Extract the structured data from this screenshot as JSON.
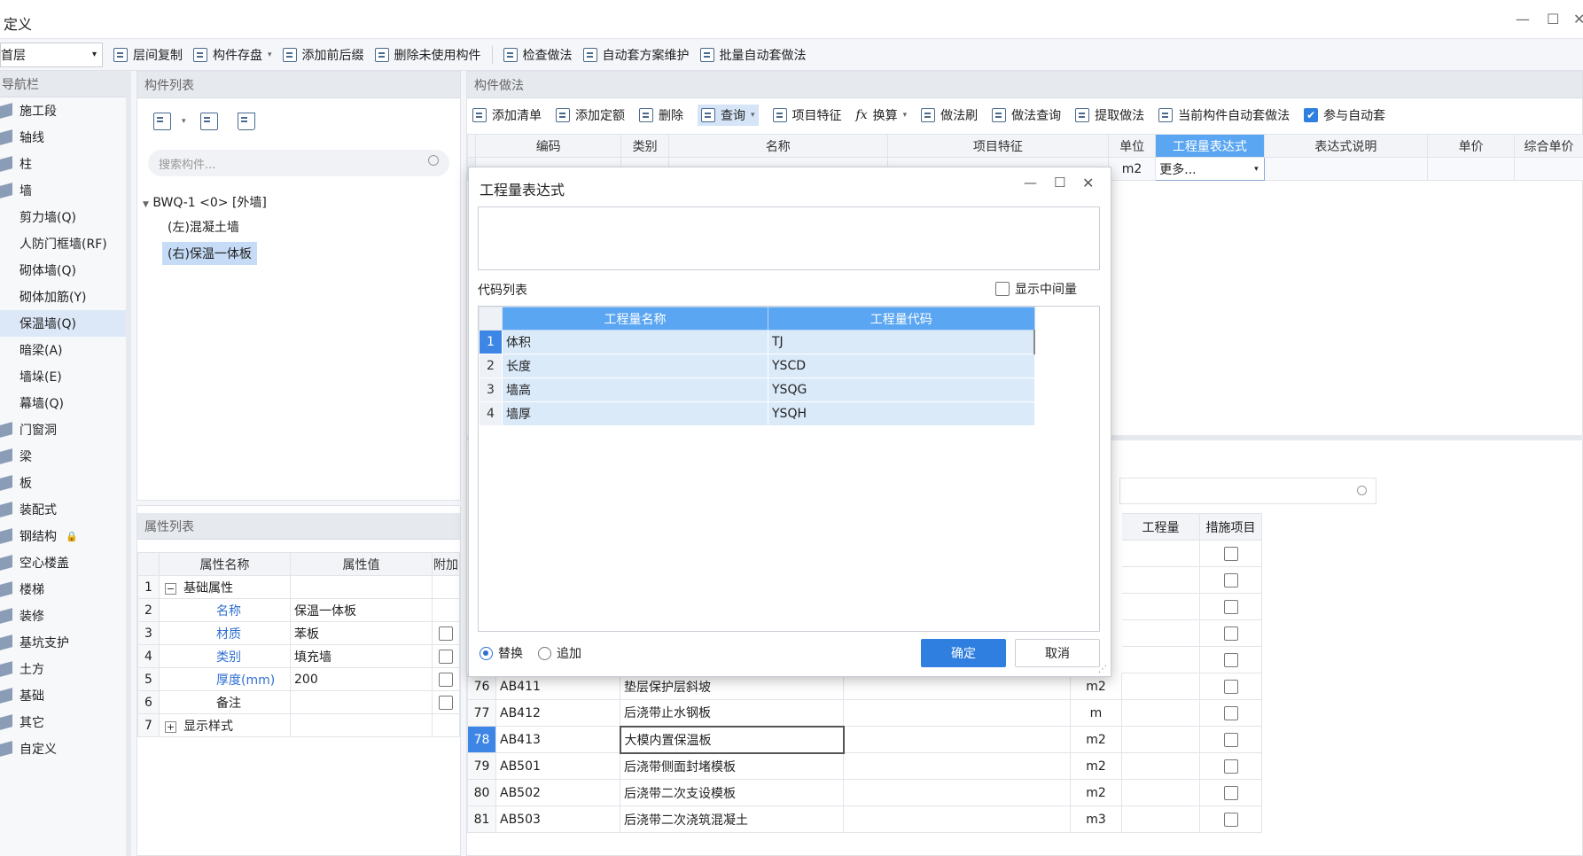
{
  "window": {
    "title": "定义",
    "minimize": "—",
    "maximize": "☐",
    "close": "✕"
  },
  "toolbar": {
    "floor": "首层",
    "items": [
      "层间复制",
      "构件存盘",
      "添加前后缀",
      "删除未使用构件",
      "检查做法",
      "自动套方案维护",
      "批量自动套做法"
    ]
  },
  "nav": {
    "header": "导航栏",
    "items": [
      {
        "label": "施工段",
        "sub": false
      },
      {
        "label": "轴线",
        "sub": false
      },
      {
        "label": "柱",
        "sub": false
      },
      {
        "label": "墙",
        "sub": false
      },
      {
        "label": "剪力墙(Q)",
        "sub": true
      },
      {
        "label": "人防门框墙(RF)",
        "sub": true
      },
      {
        "label": "砌体墙(Q)",
        "sub": true
      },
      {
        "label": "砌体加筋(Y)",
        "sub": true
      },
      {
        "label": "保温墙(Q)",
        "sub": true,
        "selected": true
      },
      {
        "label": "暗梁(A)",
        "sub": true
      },
      {
        "label": "墙垛(E)",
        "sub": true
      },
      {
        "label": "幕墙(Q)",
        "sub": true
      },
      {
        "label": "门窗洞",
        "sub": false
      },
      {
        "label": "梁",
        "sub": false
      },
      {
        "label": "板",
        "sub": false
      },
      {
        "label": "装配式",
        "sub": false
      },
      {
        "label": "钢结构",
        "sub": false
      },
      {
        "label": "空心楼盖",
        "sub": false
      },
      {
        "label": "楼梯",
        "sub": false
      },
      {
        "label": "装修",
        "sub": false
      },
      {
        "label": "基坑支护",
        "sub": false
      },
      {
        "label": "土方",
        "sub": false
      },
      {
        "label": "基础",
        "sub": false
      },
      {
        "label": "其它",
        "sub": false
      },
      {
        "label": "自定义",
        "sub": false
      }
    ]
  },
  "components": {
    "header": "构件列表",
    "search_placeholder": "搜索构件...",
    "tree_root": "BWQ-1 <0> [外墙]",
    "children": [
      "(左)混凝土墙",
      "(右)保温一体板"
    ]
  },
  "props": {
    "header": "属性列表",
    "columns": [
      "属性名称",
      "属性值",
      "附加"
    ],
    "rows": [
      {
        "n": "1",
        "name": "基础属性",
        "value": "",
        "group": "−"
      },
      {
        "n": "2",
        "name": "名称",
        "value": "保温一体板"
      },
      {
        "n": "3",
        "name": "材质",
        "value": "苯板",
        "chk": true
      },
      {
        "n": "4",
        "name": "类别",
        "value": "填充墙",
        "chk": true
      },
      {
        "n": "5",
        "name": "厚度(mm)",
        "value": "200",
        "chk": true
      },
      {
        "n": "6",
        "name": "备注",
        "value": "",
        "chk": true,
        "plain": true
      },
      {
        "n": "7",
        "name": "显示样式",
        "value": "",
        "group": "+"
      }
    ]
  },
  "method": {
    "header": "构件做法",
    "tools": [
      "添加清单",
      "添加定额",
      "删除",
      "查询",
      "项目特征",
      "换算",
      "做法刷",
      "做法查询",
      "提取做法",
      "当前构件自动套做法",
      "参与自动套"
    ],
    "columns": [
      "编码",
      "类别",
      "名称",
      "项目特征",
      "单位",
      "工程量表达式",
      "表达式说明",
      "单价",
      "综合单价"
    ],
    "row": {
      "unit": "m2",
      "expr": "更多..."
    },
    "lower_columns": [
      "工程量",
      "措施项目"
    ],
    "lower_rows": [
      {
        "n": "76",
        "code": "AB411",
        "name": "垫层保护层斜坡",
        "unit": "m2"
      },
      {
        "n": "77",
        "code": "AB412",
        "name": "后浇带止水钢板",
        "unit": "m"
      },
      {
        "n": "78",
        "code": "AB413",
        "name": "大模内置保温板",
        "unit": "m2"
      },
      {
        "n": "79",
        "code": "AB501",
        "name": "后浇带侧面封堵模板",
        "unit": "m2"
      },
      {
        "n": "80",
        "code": "AB502",
        "name": "后浇带二次支设模板",
        "unit": "m2"
      },
      {
        "n": "81",
        "code": "AB503",
        "name": "后浇带二次浇筑混凝土",
        "unit": "m3"
      }
    ]
  },
  "dialog": {
    "title": "工程量表达式",
    "code_list": "代码列表",
    "show_mid": "显示中间量",
    "columns": [
      "工程量名称",
      "工程量代码"
    ],
    "rows": [
      {
        "n": "1",
        "name": "体积",
        "code": "TJ"
      },
      {
        "n": "2",
        "name": "长度",
        "code": "YSCD"
      },
      {
        "n": "3",
        "name": "墙高",
        "code": "YSQG"
      },
      {
        "n": "4",
        "name": "墙厚",
        "code": "YSQH"
      }
    ],
    "replace": "替换",
    "append": "追加",
    "ok": "确定",
    "cancel": "取消"
  },
  "colors": {
    "accent": "#2f7fe0",
    "header_blue": "#5aa6f2",
    "row_blue": "#dbeaf9"
  }
}
